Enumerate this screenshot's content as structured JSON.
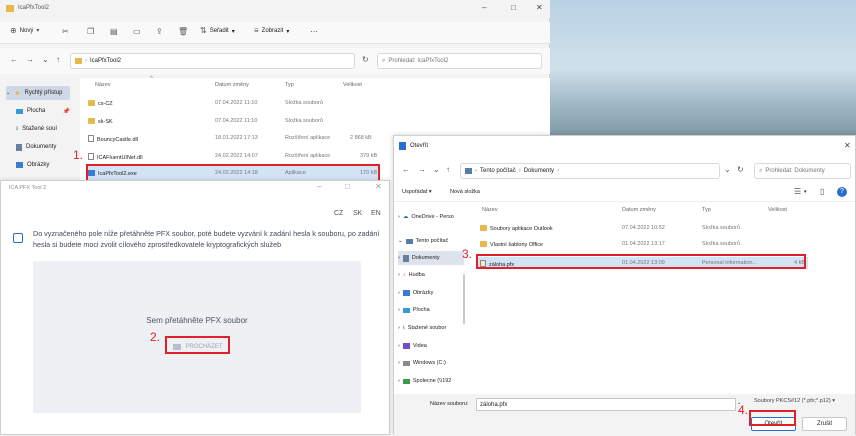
{
  "explorer": {
    "title": "IcaPfxTool2",
    "toolbar": {
      "new": "Nový",
      "sort": "Seřadit",
      "view": "Zobrazit",
      "more": "···"
    },
    "path": "IcaPfxTool2",
    "search_placeholder": "Prohledat: IcaPfxTool2",
    "sidebar": [
      {
        "label": "Rychlý přístup",
        "icon": "star-icon"
      },
      {
        "label": "Plocha",
        "icon": "desktop-icon"
      },
      {
        "label": "Stažené soul",
        "icon": "download-icon"
      },
      {
        "label": "Dokumenty",
        "icon": "documents-icon"
      },
      {
        "label": "Obrázky",
        "icon": "pictures-icon"
      }
    ],
    "columns": {
      "name": "Název",
      "date": "Datum změny",
      "type": "Typ",
      "size": "Velikost"
    },
    "files": [
      {
        "name": "cs-CZ",
        "date": "07.04.2022 11:10",
        "type": "Složka souborů",
        "size": "",
        "kind": "folder"
      },
      {
        "name": "sk-SK",
        "date": "07.04.2022 11:10",
        "type": "Složka souborů",
        "size": "",
        "kind": "folder"
      },
      {
        "name": "BouncyCastle.dll",
        "date": "18.01.2022 17:13",
        "type": "Rozšíření aplikace",
        "size": "2 868 kB",
        "kind": "file"
      },
      {
        "name": "ICAFluentUINet.dll",
        "date": "24.02.2022 14:07",
        "type": "Rozšíření aplikace",
        "size": "379 kB",
        "kind": "file"
      },
      {
        "name": "IcaPfxTool2.exe",
        "date": "24.02.2022 14:18",
        "type": "Aplikace",
        "size": "170 kB",
        "kind": "exe"
      }
    ]
  },
  "ica": {
    "title": "ICA PFX Tool 2",
    "langs": [
      "CZ",
      "SK",
      "EN"
    ],
    "instruction": "Do vyznačeného pole níže přetáhněte PFX soubor, poté budete vyzvání k zadání hesla k souboru, po zadání hesla si budete moci zvolit cílového zprostředkovatele kryptografických služeb",
    "drop_text": "Sem přetáhněte PFX soubor",
    "browse_label": "PROCHÁZET"
  },
  "open_dialog": {
    "title": "Otevřít",
    "breadcrumb": [
      "Tento počítač",
      "Dokumenty"
    ],
    "search_placeholder": "Prohledat: Dokumenty",
    "organize": "Uspořádat",
    "new_folder": "Nová složka",
    "sidebar": [
      {
        "label": "OneDrive - Perso",
        "icon": "cloud-icon"
      },
      {
        "label": "Tento počítač",
        "icon": "computer-icon"
      },
      {
        "label": "Dokumenty",
        "icon": "documents-icon"
      },
      {
        "label": "Hudba",
        "icon": "music-icon"
      },
      {
        "label": "Obrázky",
        "icon": "pictures-icon"
      },
      {
        "label": "Plocha",
        "icon": "desktop-icon"
      },
      {
        "label": "Stažené soubor",
        "icon": "download-icon"
      },
      {
        "label": "Videa",
        "icon": "video-icon"
      },
      {
        "label": "Windows (C:)",
        "icon": "drive-icon"
      },
      {
        "label": "Spolecne (\\\\192",
        "icon": "network-drive-icon"
      }
    ],
    "columns": {
      "name": "Název",
      "date": "Datum změny",
      "type": "Typ",
      "size": "Velikost"
    },
    "files": [
      {
        "name": "Soubory aplikace Outlook",
        "date": "07.04.2022 10:52",
        "type": "Složka souborů",
        "size": ""
      },
      {
        "name": "Vlastní šablony Office",
        "date": "01.04.2022 13:17",
        "type": "Složka souborů",
        "size": ""
      },
      {
        "name": "záloha.pfx",
        "date": "01.04.2022 13:09",
        "type": "Personal information...",
        "size": "4 kB"
      }
    ],
    "filename_label": "Název souboru:",
    "filename_value": "záloha.pfx",
    "filetype": "Soubory PKCS#12 (*.pfx;*.p12)",
    "open_button": "Otevřít",
    "cancel_button": "Zrušit"
  },
  "steps": [
    "1.",
    "2.",
    "3.",
    "4."
  ],
  "colors": {
    "highlight": "#e0202a",
    "selection": "#d3e3f6",
    "folder": "#e8b84a",
    "accent": "#3a7bd5"
  }
}
